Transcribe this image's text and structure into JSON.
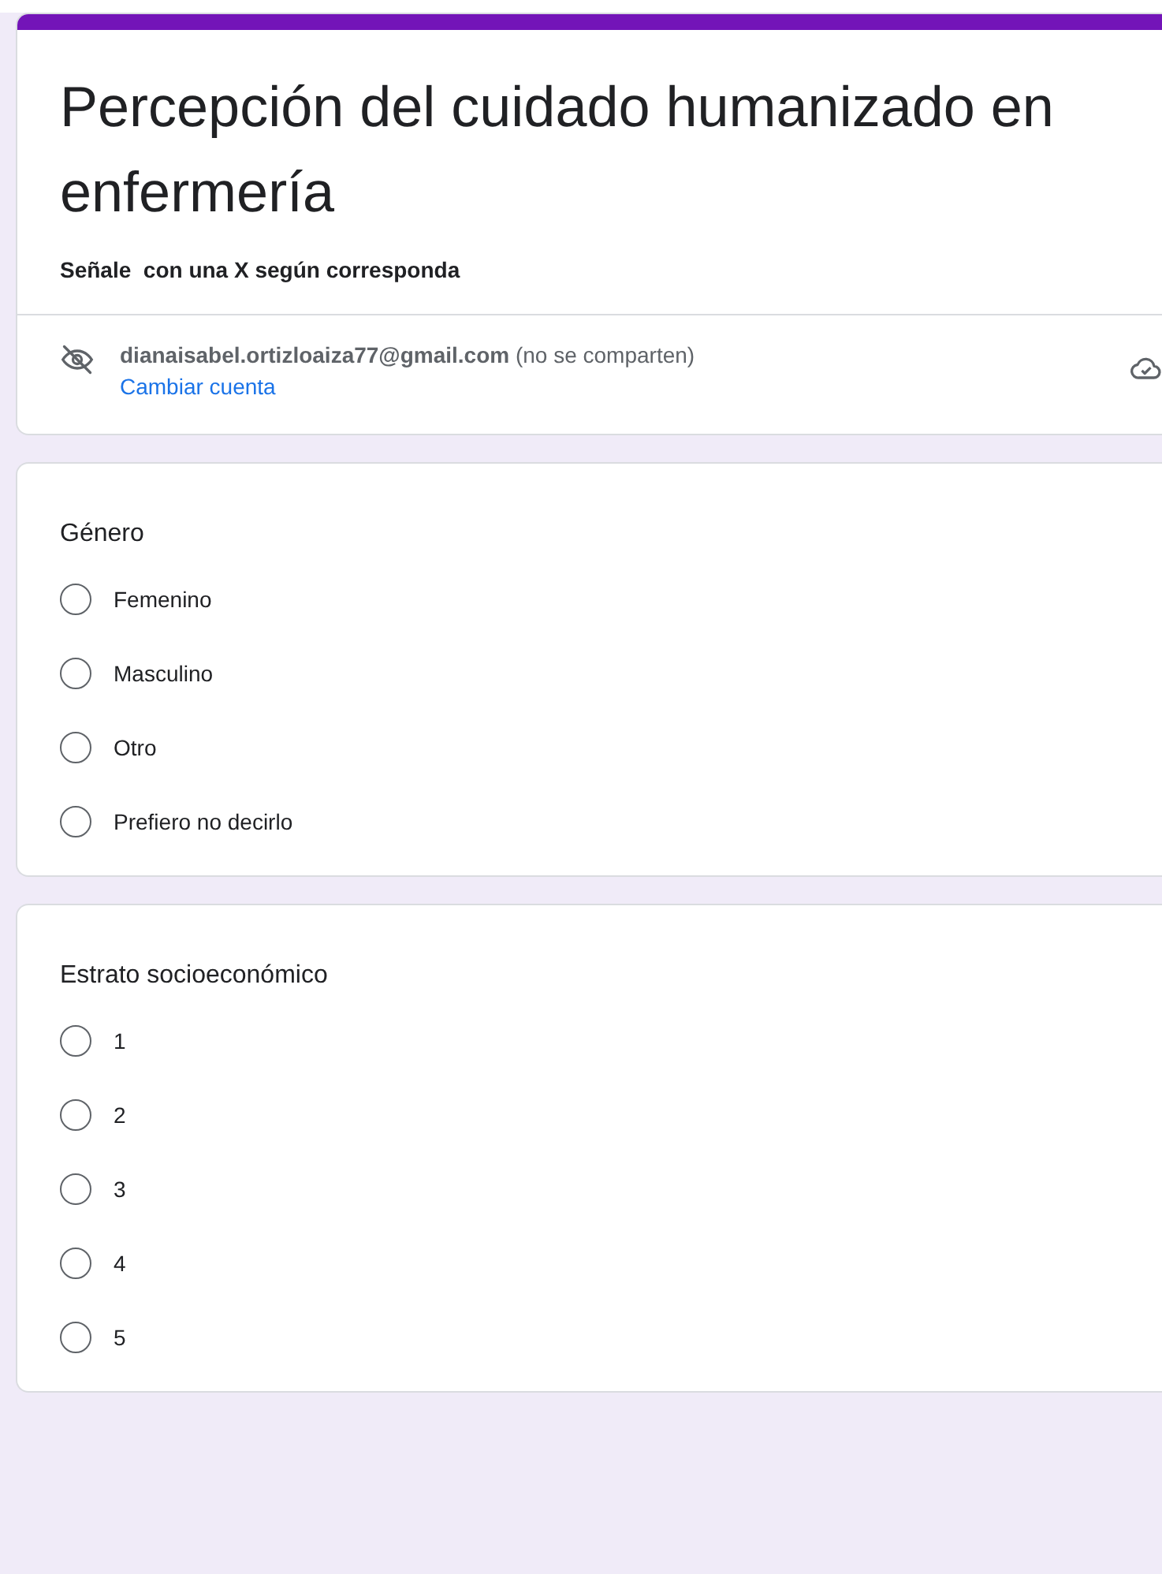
{
  "form": {
    "title": "Percepción del cuidado humanizado en enfermería",
    "description": "Señale  con una X según corresponda",
    "account": {
      "email": "dianaisabel.ortizloaiza77@gmail.com",
      "note": "(no se comparten)",
      "switch_link": "Cambiar cuenta"
    }
  },
  "questions": [
    {
      "title": "Género",
      "options": [
        {
          "label": "Femenino",
          "selected": false
        },
        {
          "label": "Masculino",
          "selected": false
        },
        {
          "label": "Otro",
          "selected": false
        },
        {
          "label": "Prefiero no decirlo",
          "selected": false
        }
      ]
    },
    {
      "title": "Estrato socioeconómico",
      "options": [
        {
          "label": "1",
          "selected": false
        },
        {
          "label": "2",
          "selected": false
        },
        {
          "label": "3",
          "selected": false
        },
        {
          "label": "4",
          "selected": false
        },
        {
          "label": "5",
          "selected": false
        }
      ]
    }
  ]
}
